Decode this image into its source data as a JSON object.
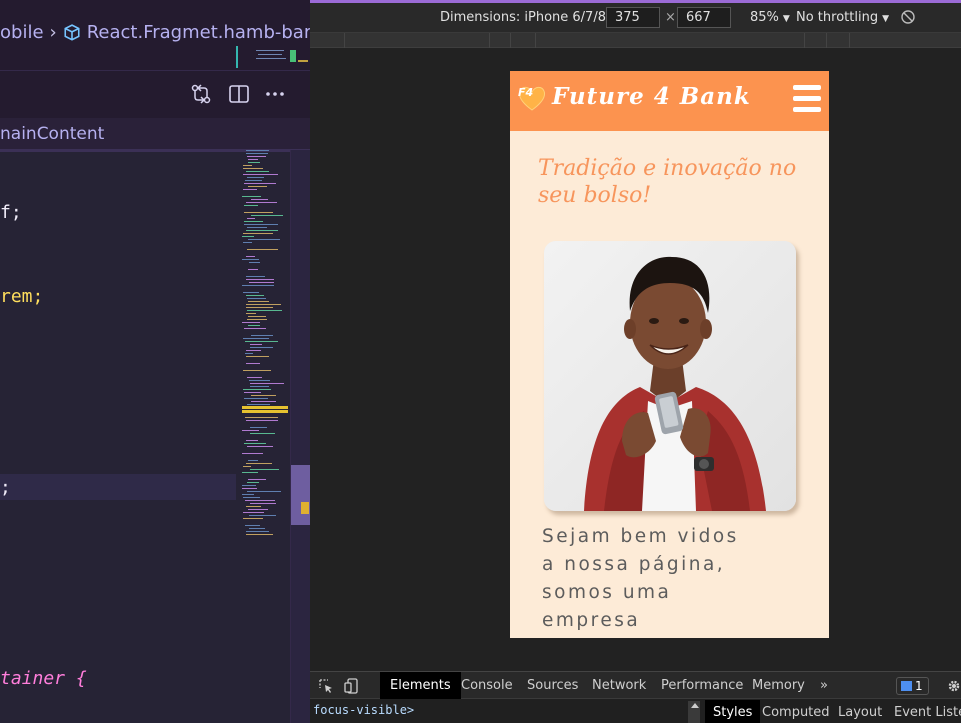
{
  "editor": {
    "breadcrumb": {
      "part1": "obile",
      "part2": "React.Fragmet.hamb-bars"
    },
    "subbar_text": "nainContent",
    "code_lines": [
      {
        "text": "f;",
        "color": "#f0ecf9"
      },
      {
        "text": "rem;",
        "color": "#fede5d"
      },
      {
        "text": ";",
        "color": "#f0ecf9"
      },
      {
        "text": "tainer {",
        "color": "#ff7edb"
      }
    ]
  },
  "devtools": {
    "device": {
      "dimensions_label": "Dimensions: iPhone 6/7/8",
      "width": "375",
      "height": "667",
      "zoom": "85%",
      "throttling": "No throttling"
    },
    "tabs": [
      "Elements",
      "Console",
      "Sources",
      "Network",
      "Performance",
      "Memory"
    ],
    "active_tab": "Elements",
    "more_tabs": "»",
    "issues_count": "1",
    "breadcrumb_selector": "focus-visible>",
    "style_tabs": [
      "Styles",
      "Computed",
      "Layout",
      "Event Listene"
    ]
  },
  "page": {
    "logo_text": "F4",
    "brand": "Future 4 Bank",
    "tagline": "Tradição e inovação no seu bolso!",
    "welcome": "Sejam bem vidos a nossa página, somos uma empresa",
    "colors": {
      "header": "#fc934f",
      "background": "#fdebd7",
      "tagline": "#f7955c"
    }
  }
}
